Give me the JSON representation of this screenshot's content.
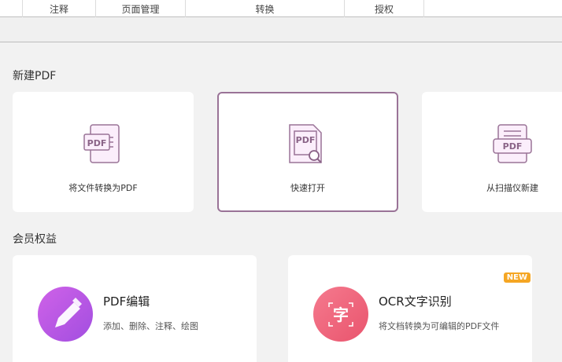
{
  "toolbar": {
    "items": [
      "注释",
      "页面管理",
      "转换",
      "授权"
    ]
  },
  "new_pdf": {
    "title": "新建PDF",
    "cards": [
      {
        "label": "将文件转换为PDF"
      },
      {
        "label": "快速打开"
      },
      {
        "label": "从扫描仪新建"
      }
    ]
  },
  "member": {
    "title": "会员权益",
    "cards": [
      {
        "title": "PDF编辑",
        "desc": "添加、删除、注释、绘图"
      },
      {
        "title": "OCR文字识别",
        "desc": "将文档转换为可编辑的PDF文件",
        "badge": "NEW"
      }
    ]
  },
  "icon_text": {
    "pdf": "PDF",
    "ocr": "字"
  },
  "colors": {
    "accent": "#9a7397",
    "edit": "#b655e0",
    "ocr": "#f0607a",
    "badge": "#f5a623"
  }
}
